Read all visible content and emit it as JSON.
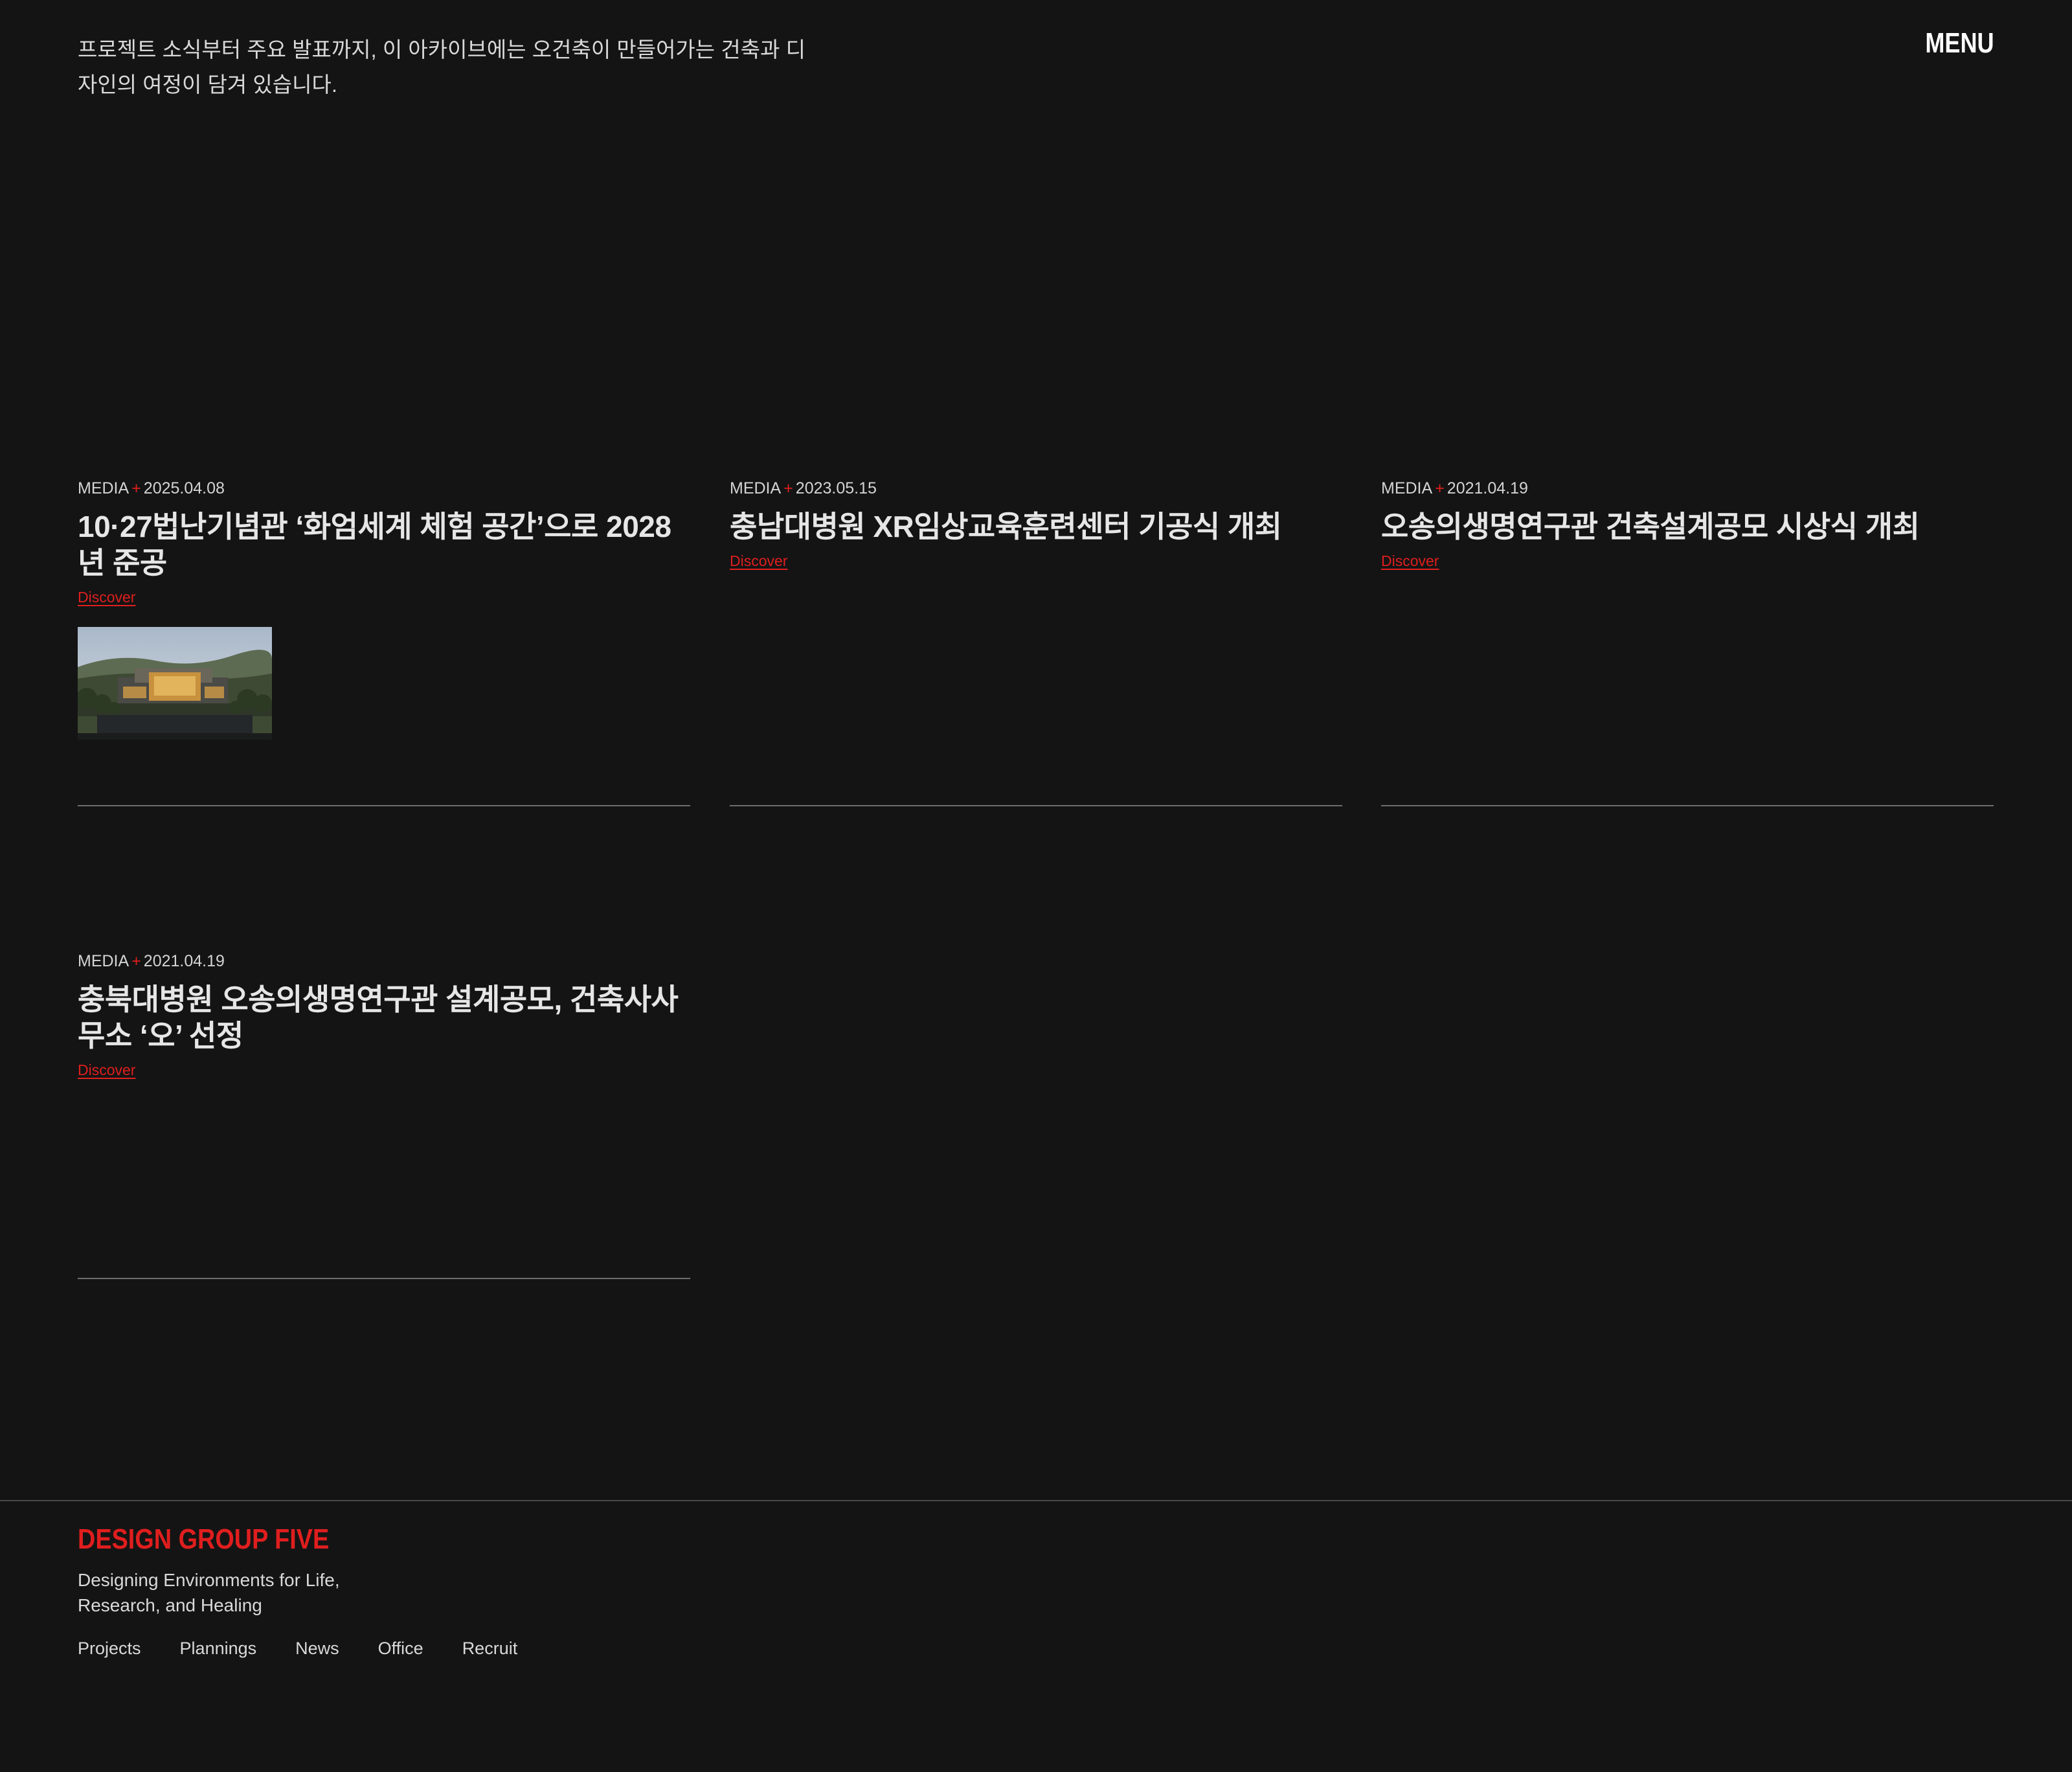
{
  "header": {
    "intro": "프로젝트 소식부터 주요 발표까지, 이 아카이브에는 오건축이 만들어가는 건축과 디자인의 여정이 담겨 있습니다.",
    "menu_label": "MENU"
  },
  "posts": [
    {
      "category": "MEDIA",
      "date": "2025.04.08",
      "title": "10·27법난기념관 ‘화엄세계 체험 공간’으로 2028년 준공",
      "link_label": "Discover",
      "has_thumbnail": true
    },
    {
      "category": "MEDIA",
      "date": "2023.05.15",
      "title": "충남대병원 XR임상교육훈련센터 기공식 개최",
      "link_label": "Discover",
      "has_thumbnail": false
    },
    {
      "category": "MEDIA",
      "date": "2021.04.19",
      "title": "오송의생명연구관 건축설계공모 시상식 개최",
      "link_label": "Discover",
      "has_thumbnail": false
    },
    {
      "category": "MEDIA",
      "date": "2021.04.19",
      "title": "충북대병원 오송의생명연구관 설계공모, 건축사사무소 ‘오’ 선정",
      "link_label": "Discover",
      "has_thumbnail": false
    }
  ],
  "footer": {
    "brand": "DESIGN GROUP FIVE",
    "tagline": "Designing Environments for Life, Research, and Healing",
    "nav": [
      "Projects",
      "Plannings",
      "News",
      "Office",
      "Recruit"
    ]
  },
  "colors": {
    "background": "#141414",
    "accent": "#e01e1e",
    "text": "#e6e6e6",
    "rule": "#6e6e6e"
  }
}
